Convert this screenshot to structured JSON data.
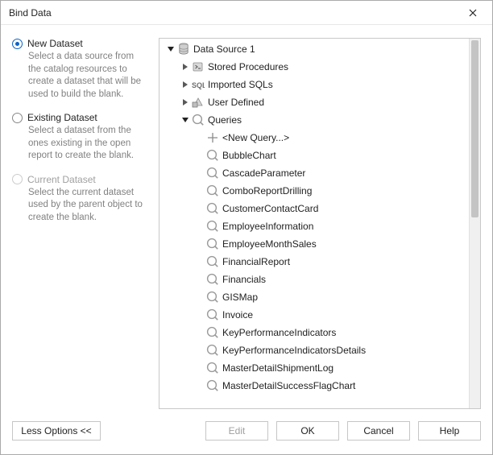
{
  "window": {
    "title": "Bind Data"
  },
  "options": {
    "new": {
      "label": "New Dataset",
      "desc": "Select a data source from the catalog resources to create a dataset that will be used to build the blank.",
      "selected": true,
      "enabled": true
    },
    "existing": {
      "label": "Existing Dataset",
      "desc": "Select a dataset from the ones existing in the open report to create the blank.",
      "selected": false,
      "enabled": true
    },
    "current": {
      "label": "Current Dataset",
      "desc": "Select the current dataset used by the parent object to create the blank.",
      "selected": false,
      "enabled": false
    }
  },
  "tree": {
    "root": {
      "label": "Data Source 1",
      "icon": "database",
      "expanded": true
    },
    "folders": [
      {
        "label": "Stored Procedures",
        "icon": "stored-proc",
        "expanded": false
      },
      {
        "label": "Imported SQLs",
        "icon": "sql-text",
        "expanded": false
      },
      {
        "label": "User Defined",
        "icon": "user-defined",
        "expanded": false
      },
      {
        "label": "Queries",
        "icon": "query",
        "expanded": true
      }
    ],
    "newQueryLabel": "<New Query...>",
    "queries": [
      "BubbleChart",
      "CascadeParameter",
      "ComboReportDrilling",
      "CustomerContactCard",
      "EmployeeInformation",
      "EmployeeMonthSales",
      "FinancialReport",
      "Financials",
      "GISMap",
      "Invoice",
      "KeyPerformanceIndicators",
      "KeyPerformanceIndicatorsDetails",
      "MasterDetailShipmentLog",
      "MasterDetailSuccessFlagChart"
    ]
  },
  "buttons": {
    "less": "Less Options <<",
    "edit": "Edit",
    "ok": "OK",
    "cancel": "Cancel",
    "help": "Help"
  }
}
